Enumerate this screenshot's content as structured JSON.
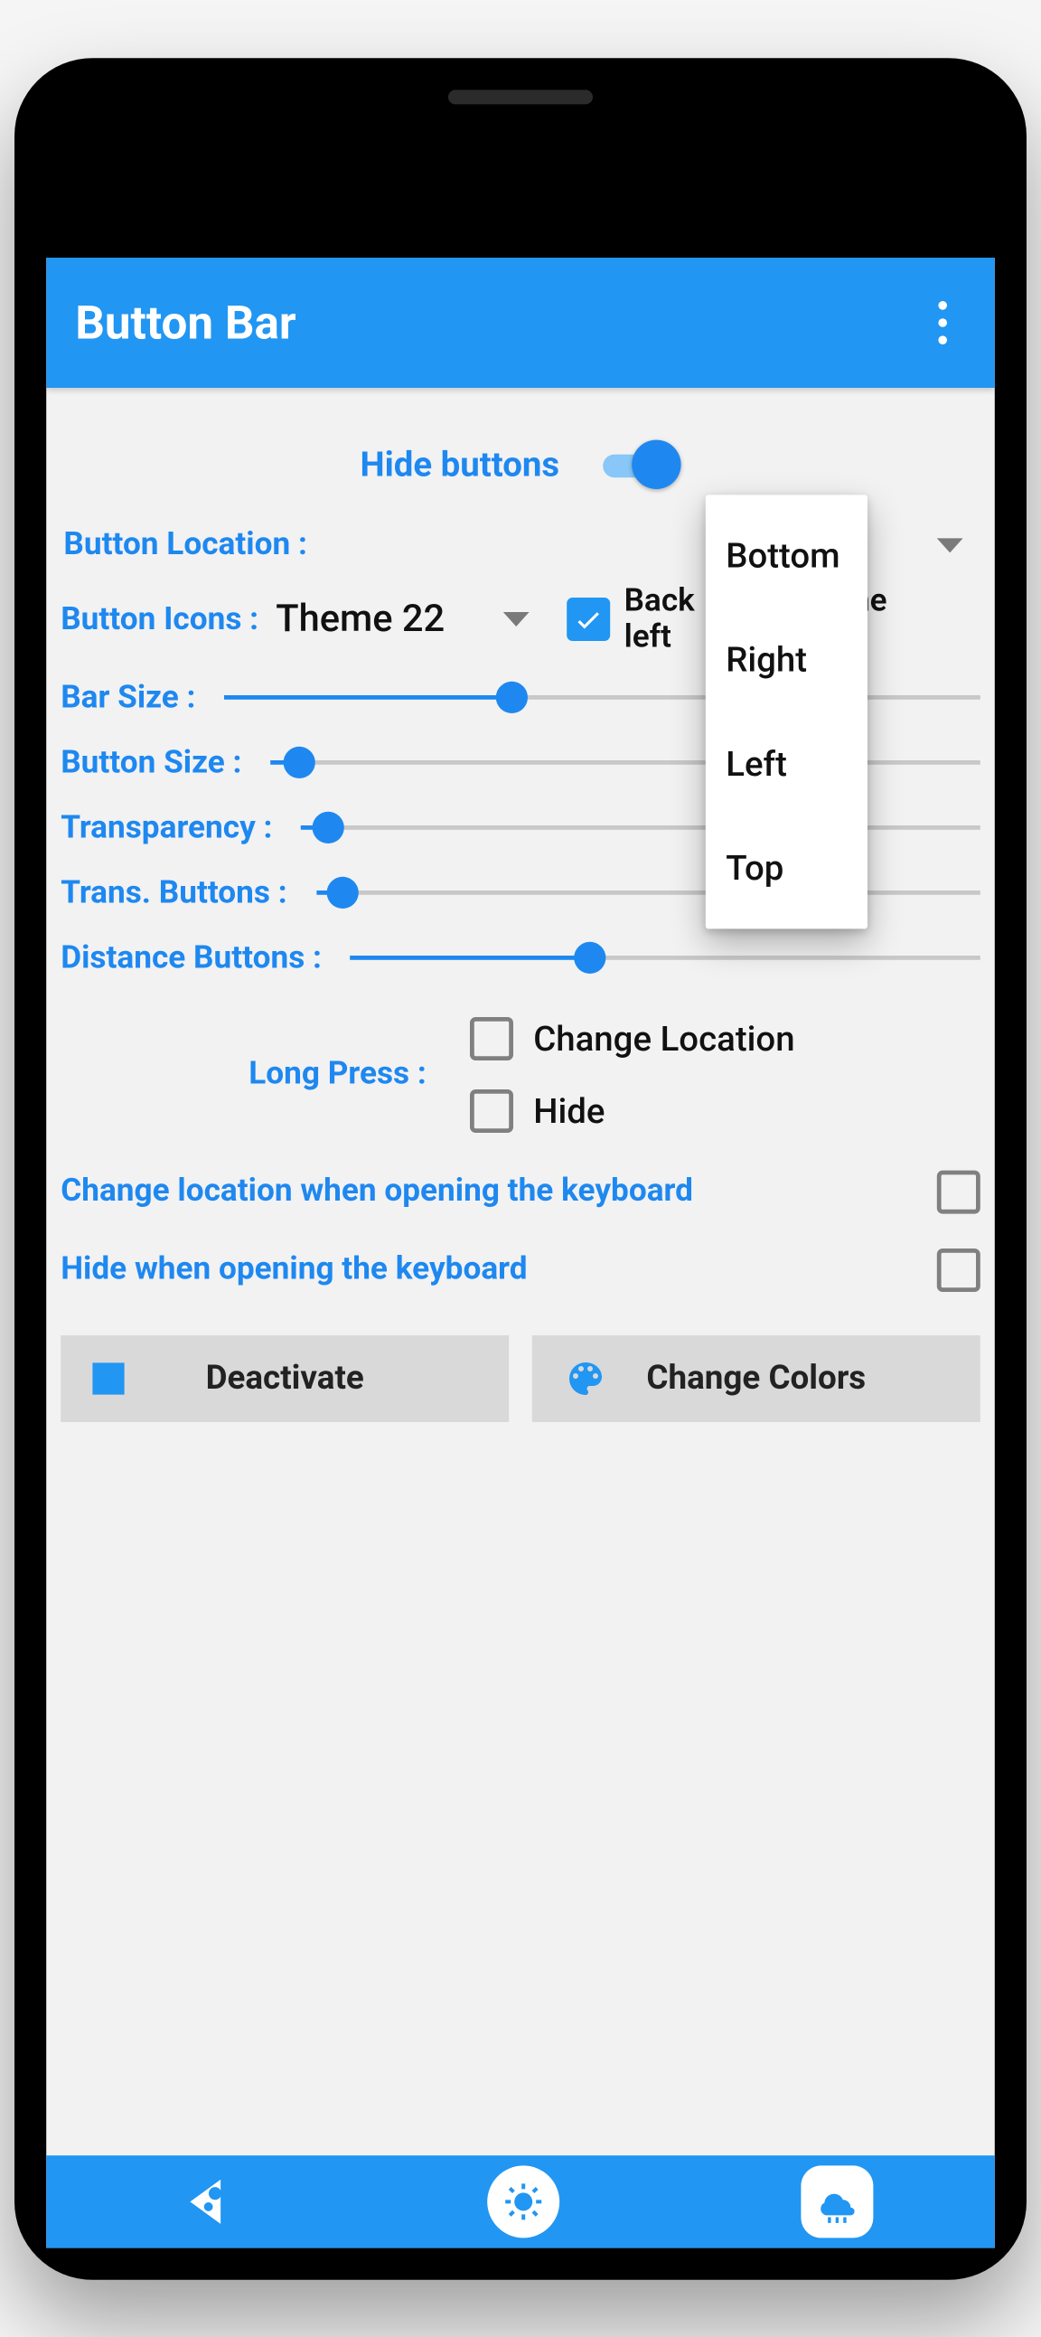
{
  "appbar": {
    "title": "Button Bar"
  },
  "hide_buttons": {
    "label": "Hide buttons",
    "on": true
  },
  "button_location": {
    "label": "Button Location :"
  },
  "button_icons": {
    "label": "Button Icons :",
    "value": "Theme 22"
  },
  "back_left": {
    "label_a": "Back",
    "label_b": "the",
    "label_c": "left",
    "checked": true
  },
  "sliders": {
    "bar_size": {
      "label": "Bar Size :",
      "pct": 38
    },
    "button_size": {
      "label": "Button Size :",
      "pct": 4
    },
    "transparency": {
      "label": "Transparency :",
      "pct": 4
    },
    "trans_btn": {
      "label": "Trans. Buttons :",
      "pct": 4
    },
    "distance": {
      "label": "Distance Buttons :",
      "pct": 38
    }
  },
  "long_press": {
    "label": "Long Press :",
    "opt_change": "Change Location",
    "opt_hide": "Hide"
  },
  "kb_change": {
    "label": "Change location when opening the keyboard",
    "checked": false
  },
  "kb_hide": {
    "label": "Hide when opening the keyboard",
    "checked": false
  },
  "actions": {
    "deactivate": "Deactivate",
    "colors": "Change Colors"
  },
  "popup": {
    "bottom": "Bottom",
    "right": "Right",
    "left": "Left",
    "top": "Top"
  }
}
